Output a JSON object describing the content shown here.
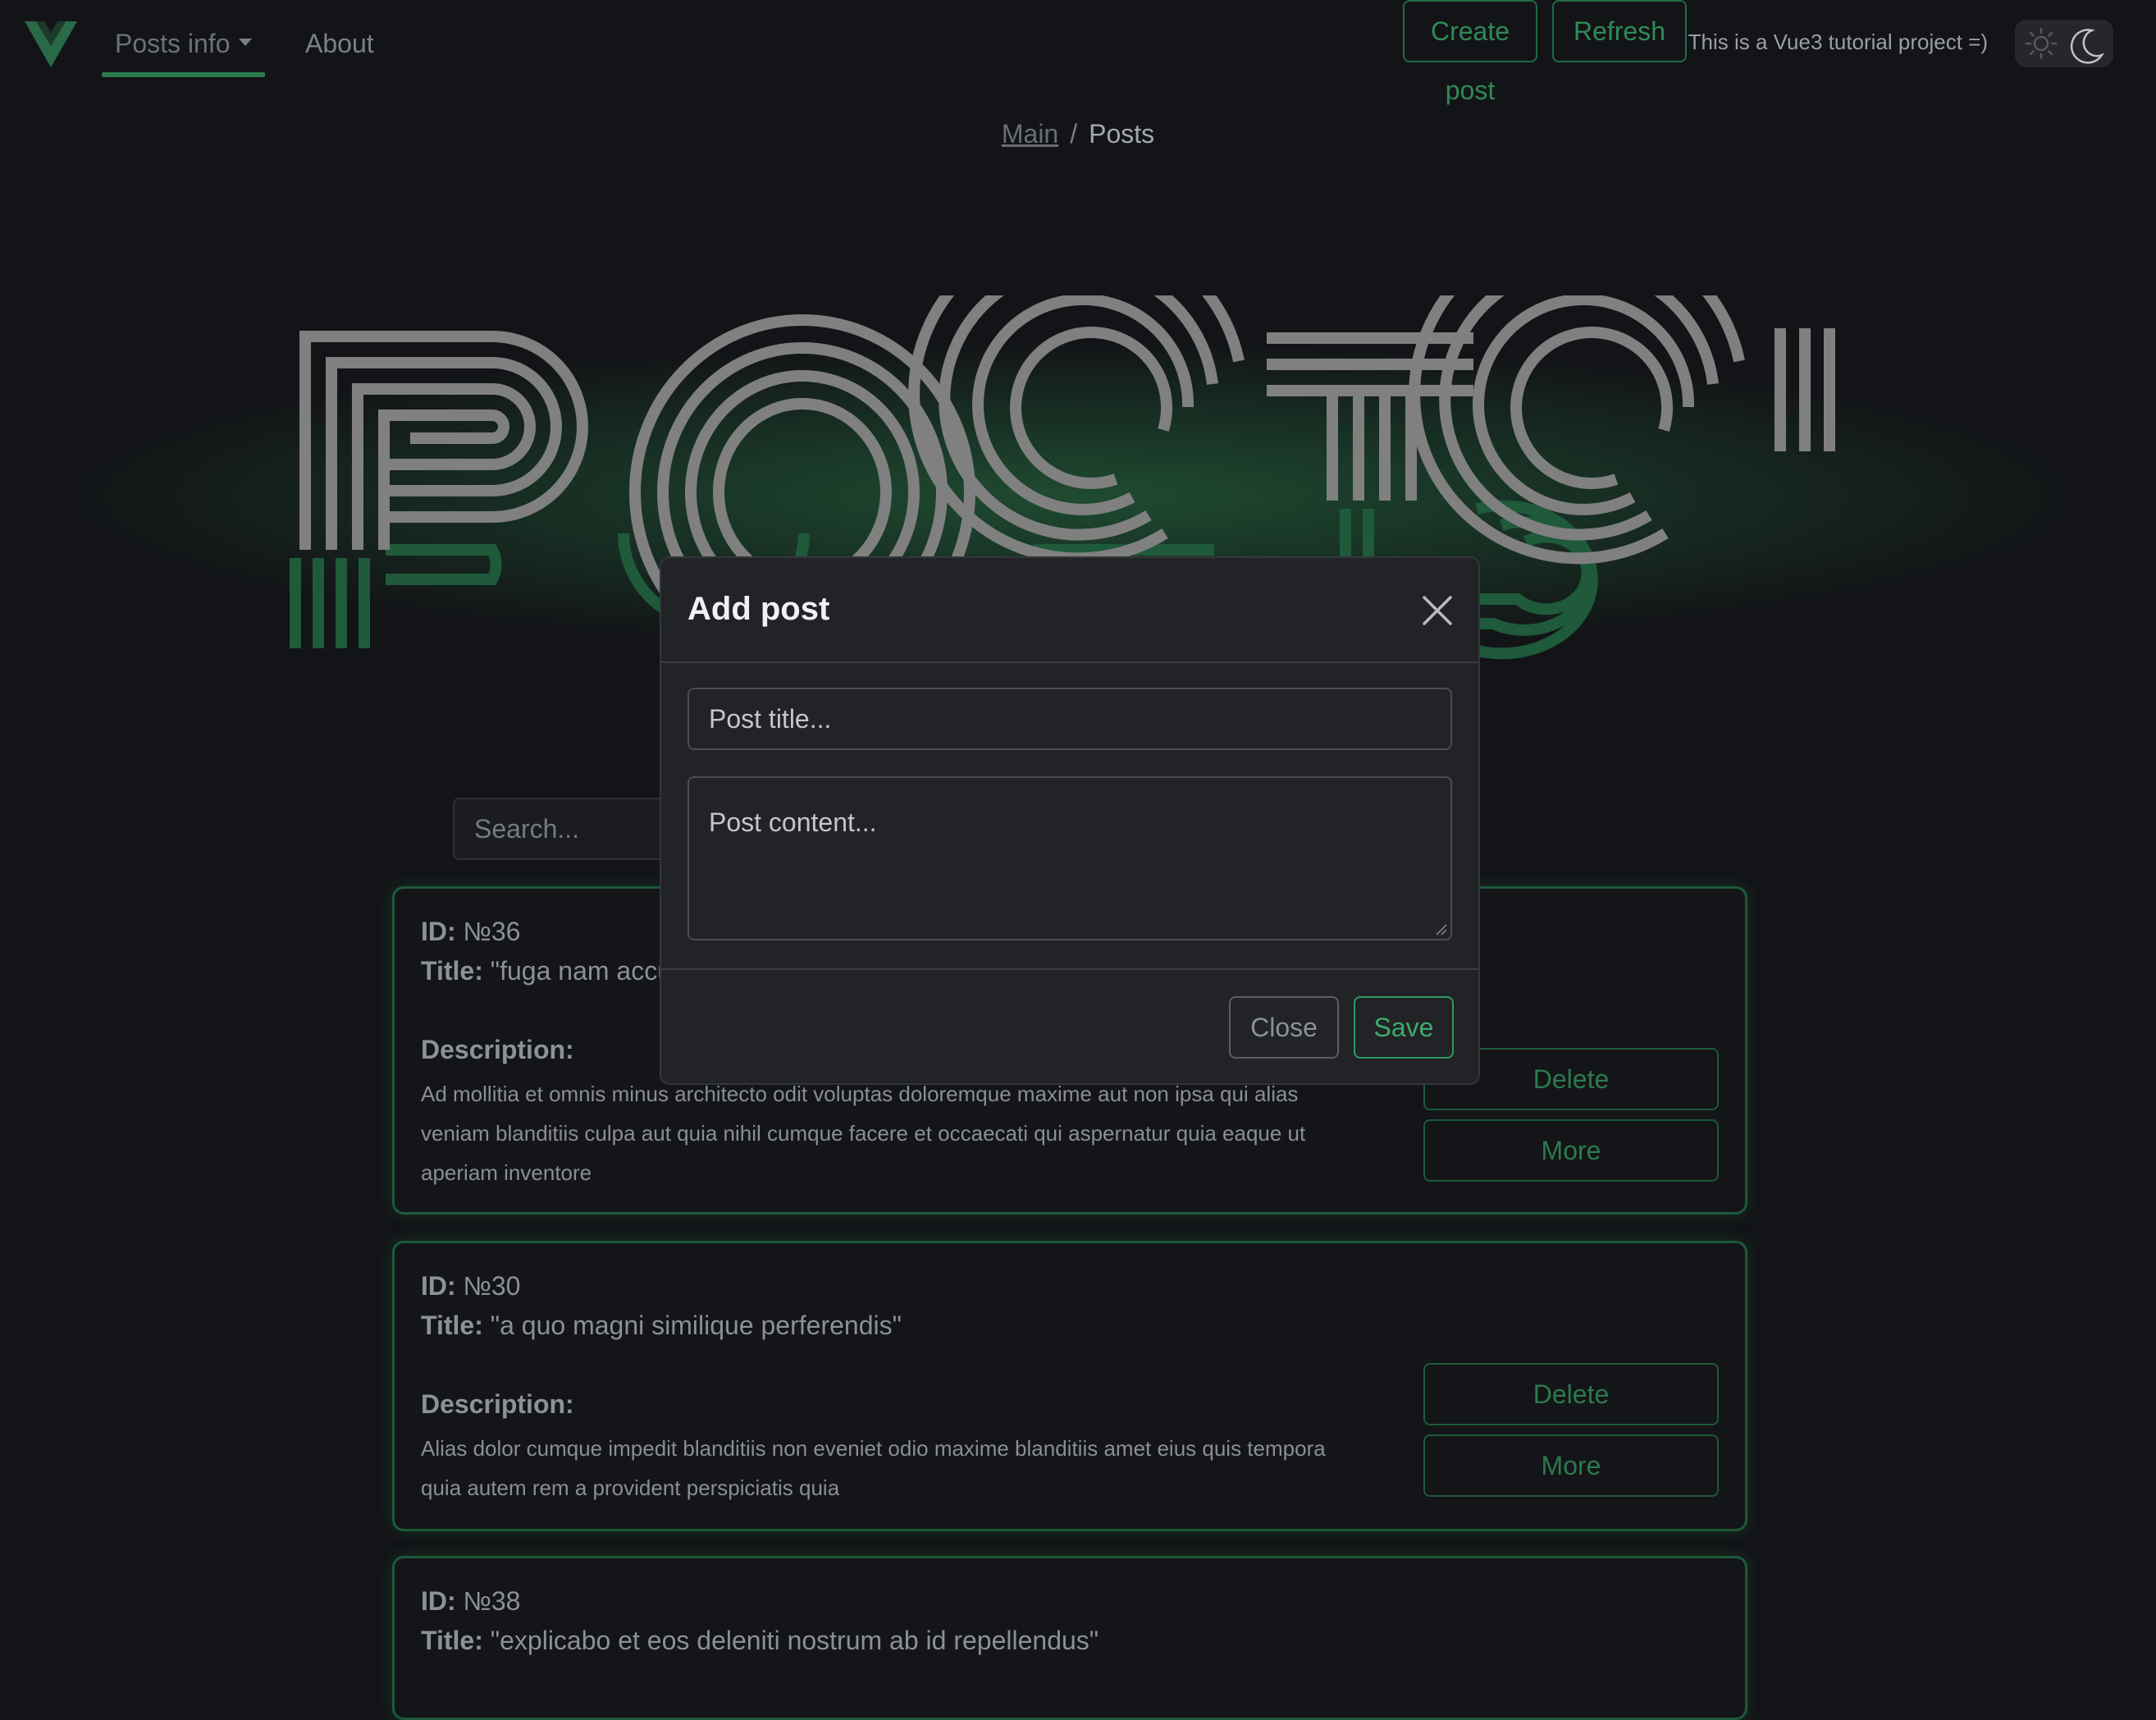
{
  "nav": {
    "items": [
      {
        "label": "Posts info"
      },
      {
        "label": "About"
      }
    ],
    "note": "This is a Vue3 tutorial project =)",
    "theme": {
      "light_icon": "sun-icon",
      "dark_icon": "moon-icon"
    }
  },
  "breadcrumb": {
    "link": "Main",
    "separator": "/",
    "current": "Posts"
  },
  "hero": {
    "title": "POSTS"
  },
  "toolbar": {
    "search_placeholder": "Search...",
    "create_label": "Create post",
    "refresh_label": "Refresh"
  },
  "labels": {
    "id": "ID:",
    "title": "Title:",
    "description": "Description:"
  },
  "posts": [
    {
      "id": "№36",
      "title": "\"fuga nam accusamus voluptas reiciendis itaque\"",
      "description": "Ad mollitia et omnis minus architecto odit voluptas doloremque maxime aut non ipsa qui alias veniam blanditiis culpa aut quia nihil cumque facere et occaecati qui aspernatur quia eaque ut aperiam inventore",
      "delete_label": "Delete",
      "more_label": "More"
    },
    {
      "id": "№30",
      "title": "\"a quo magni similique perferendis\"",
      "description": "Alias dolor cumque impedit blanditiis non eveniet odio maxime blanditiis amet eius quis tempora quia autem rem a provident perspiciatis quia",
      "delete_label": "Delete",
      "more_label": "More"
    },
    {
      "id": "№38",
      "title": "\"explicabo et eos deleniti nostrum ab id repellendus\""
    }
  ],
  "modal": {
    "title": "Add post",
    "title_placeholder": "Post title...",
    "content_placeholder": "Post content...",
    "close_label": "Close",
    "save_label": "Save"
  },
  "colors": {
    "background": "#131417",
    "accent": "#2b7a4e",
    "modal_bg": "#212327"
  }
}
